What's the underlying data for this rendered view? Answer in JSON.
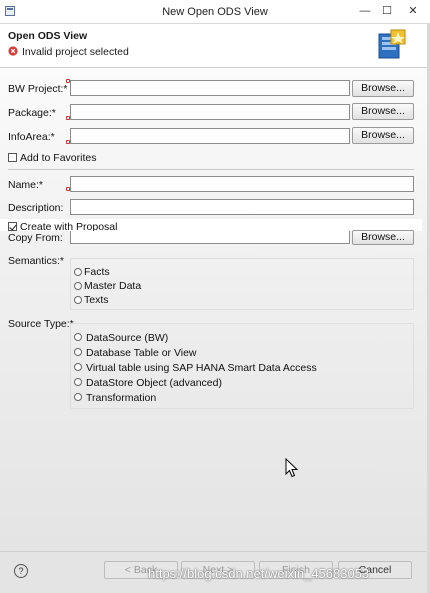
{
  "window": {
    "title": "New Open ODS View",
    "controls": {
      "minimize": "—",
      "maximize": "☐",
      "close": "✕"
    }
  },
  "header": {
    "title": "Open ODS View",
    "error_message": "Invalid project selected",
    "error_icon": "error-circle-icon",
    "wizard_icon": "ods-view-wizard-icon"
  },
  "form": {
    "bw_project_label": "BW Project:*",
    "package_label": "Package:*",
    "infoarea_label": "InfoArea:*",
    "browse_label": "Browse...",
    "add_to_favorites_label": "Add to Favorites",
    "add_to_favorites_checked": false,
    "name_label": "Name:*",
    "description_label": "Description:",
    "create_with_proposal_label": "Create with Proposal",
    "create_with_proposal_checked": true,
    "copy_from_label": "Copy From:",
    "bw_project_value": "",
    "package_value": "",
    "infoarea_value": "",
    "name_value": "",
    "description_value": "",
    "copy_from_value": ""
  },
  "semantics": {
    "label": "Semantics:*",
    "options": [
      "Facts",
      "Master Data",
      "Texts"
    ]
  },
  "source_type": {
    "label": "Source Type:*",
    "options": [
      "DataSource (BW)",
      "Database Table or View",
      "Virtual table using SAP HANA Smart Data Access",
      "DataStore Object (advanced)",
      "Transformation"
    ]
  },
  "footer": {
    "help": "?",
    "back_label": "< Back",
    "next_label": "Next >",
    "finish_label": "Finish",
    "cancel_label": "Cancel",
    "watermark": "https://blog.csdn.net/weixin_45683053"
  }
}
